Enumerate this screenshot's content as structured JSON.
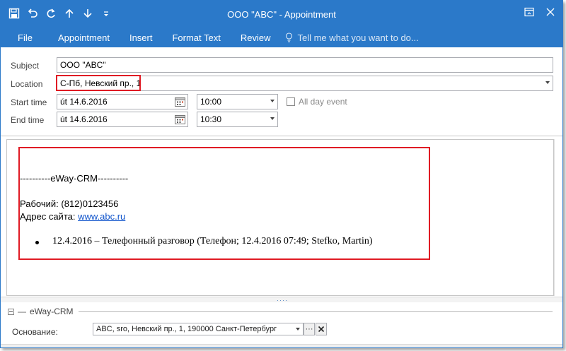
{
  "window": {
    "title": "ООО \"ABC\" - Appointment"
  },
  "ribbon": {
    "tabs": [
      "File",
      "Appointment",
      "Insert",
      "Format Text",
      "Review"
    ],
    "tell_me": "Tell me what you want to do..."
  },
  "form": {
    "subject_label": "Subject",
    "subject_value": "ООО \"ABC\"",
    "location_label": "Location",
    "location_value": "С-Пб, Невский пр., 1",
    "start_label": "Start time",
    "start_date": "út 14.6.2016",
    "start_time": "10:00",
    "end_label": "End time",
    "end_date": "út 14.6.2016",
    "end_time": "10:30",
    "all_day_label": "All day event"
  },
  "body": {
    "separator": "----------eWay-CRM----------",
    "phone_line": "Рабочий: (812)0123456",
    "site_label": "Адрес сайта: ",
    "site_link": "www.abc.ru",
    "bullet_item": "12.4.2016 – Телефонный разговор (Телефон; 12.4.2016 07:49; Stefko, Martin)"
  },
  "eway_panel": {
    "title": "eWay-CRM",
    "field_label": "Основание:",
    "field_value": "ABC, sro, Невский пр., 1, 190000 Санкт-Петербург"
  },
  "colors": {
    "accent": "#2b79c9",
    "highlight": "#e01b24",
    "link": "#1155cc"
  },
  "icons": [
    "save-icon",
    "undo-icon",
    "redo-icon",
    "up-arrow-icon",
    "down-arrow-icon",
    "customize-qat-icon",
    "ribbon-display-icon",
    "close-icon",
    "lightbulb-icon",
    "calendar-icon"
  ]
}
